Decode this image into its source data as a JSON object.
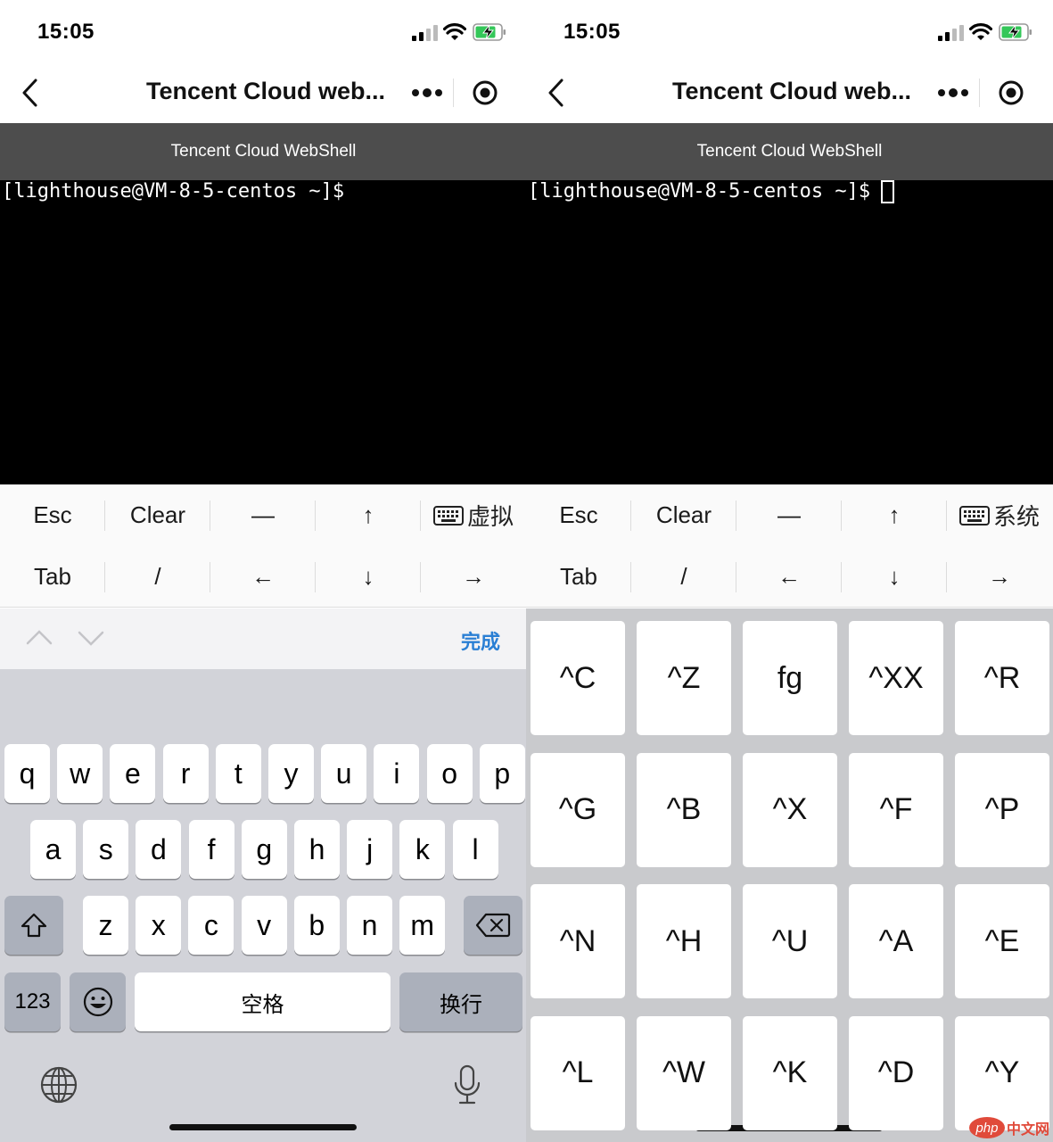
{
  "status_bar": {
    "time": "15:05"
  },
  "nav": {
    "title": "Tencent Cloud web..."
  },
  "shell_header": {
    "title": "Tencent Cloud WebShell"
  },
  "terminal": {
    "prompt": "[lighthouse@VM-8-5-centos ~]$"
  },
  "shortcut_bar": {
    "row1": [
      "Esc",
      "Clear",
      "—",
      "↑"
    ],
    "row2": [
      "Tab",
      "/",
      "←",
      "↓",
      "→"
    ],
    "left_switch_label": "虚拟",
    "right_switch_label": "系统"
  },
  "ime_bar": {
    "done_label": "完成"
  },
  "keyboard": {
    "row1": [
      "q",
      "w",
      "e",
      "r",
      "t",
      "y",
      "u",
      "i",
      "o",
      "p"
    ],
    "row2": [
      "a",
      "s",
      "d",
      "f",
      "g",
      "h",
      "j",
      "k",
      "l"
    ],
    "row3": [
      "z",
      "x",
      "c",
      "v",
      "b",
      "n",
      "m"
    ],
    "numbers_label": "123",
    "space_label": "空格",
    "return_label": "换行"
  },
  "ctrl_keys": [
    [
      "^C",
      "^Z",
      "fg",
      "^XX",
      "^R"
    ],
    [
      "^G",
      "^B",
      "^X",
      "^F",
      "^P"
    ],
    [
      "^N",
      "^H",
      "^U",
      "^A",
      "^E"
    ],
    [
      "^L",
      "^W",
      "^K",
      "^D",
      "^Y"
    ]
  ],
  "watermark": {
    "brand": "php",
    "text": "中文网"
  },
  "colors": {
    "header_bg": "#4d4d4d",
    "terminal_bg": "#000000",
    "done_blue": "#2a7fd4",
    "keyboard_bg": "#d2d3d9"
  }
}
